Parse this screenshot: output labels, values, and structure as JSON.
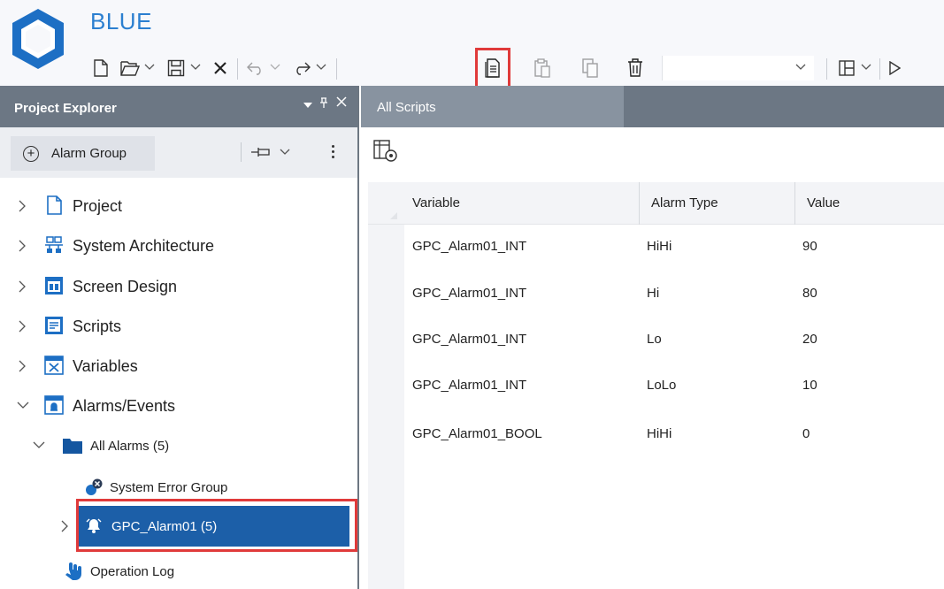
{
  "app": {
    "title": "BLUE",
    "brand_color": "#2b7fd0",
    "highlight_color": "#e03a3a"
  },
  "toolbar": {
    "buttons": [
      {
        "icon": "new-document-icon",
        "enabled": true
      },
      {
        "icon": "open-folder-icon",
        "enabled": true,
        "dropdown": true
      },
      {
        "icon": "save-icon",
        "enabled": true,
        "dropdown": true
      },
      {
        "icon": "close-icon",
        "enabled": true
      },
      {
        "icon": "undo-icon",
        "enabled": false,
        "dropdown": true
      },
      {
        "icon": "redo-icon",
        "enabled": true,
        "dropdown": true
      },
      {
        "icon": "document-icon",
        "enabled": true,
        "highlighted": true
      },
      {
        "icon": "paste-icon",
        "enabled": false
      },
      {
        "icon": "copy-icon",
        "enabled": false
      },
      {
        "icon": "delete-icon",
        "enabled": true
      },
      {
        "icon": "layout-icon",
        "enabled": true,
        "dropdown": true
      },
      {
        "icon": "play-icon",
        "enabled": true
      }
    ],
    "combo_value": ""
  },
  "project_explorer": {
    "title": "Project Explorer",
    "add_button_label": "Alarm Group",
    "tree": [
      {
        "label": "Project",
        "icon": "project-page-icon",
        "expanded": false
      },
      {
        "label": "System Architecture",
        "icon": "system-architecture-icon",
        "expanded": false
      },
      {
        "label": "Screen Design",
        "icon": "screen-design-icon",
        "expanded": false
      },
      {
        "label": "Scripts",
        "icon": "scripts-icon",
        "expanded": false
      },
      {
        "label": "Variables",
        "icon": "variables-icon",
        "expanded": false
      },
      {
        "label": "Alarms/Events",
        "icon": "alarms-events-icon",
        "expanded": true
      },
      {
        "label": "All Alarms (5)",
        "icon": "folder-icon",
        "expanded": true
      },
      {
        "label": "System Error Group",
        "icon": "system-error-icon"
      },
      {
        "label": "GPC_Alarm01 (5)",
        "icon": "alarm-bell-icon",
        "selected": true,
        "expanded": false
      },
      {
        "label": "Operation Log",
        "icon": "operation-log-icon"
      }
    ]
  },
  "editor": {
    "tab_label": "All Scripts",
    "columns": [
      "Variable",
      "Alarm Type",
      "Value"
    ],
    "rows": [
      [
        "GPC_Alarm01_INT",
        "HiHi",
        "90"
      ],
      [
        "GPC_Alarm01_INT",
        "Hi",
        "80"
      ],
      [
        "GPC_Alarm01_INT",
        "Lo",
        "20"
      ],
      [
        "GPC_Alarm01_INT",
        "LoLo",
        "10"
      ],
      [
        "GPC_Alarm01_BOOL",
        "HiHi",
        "0"
      ]
    ]
  }
}
